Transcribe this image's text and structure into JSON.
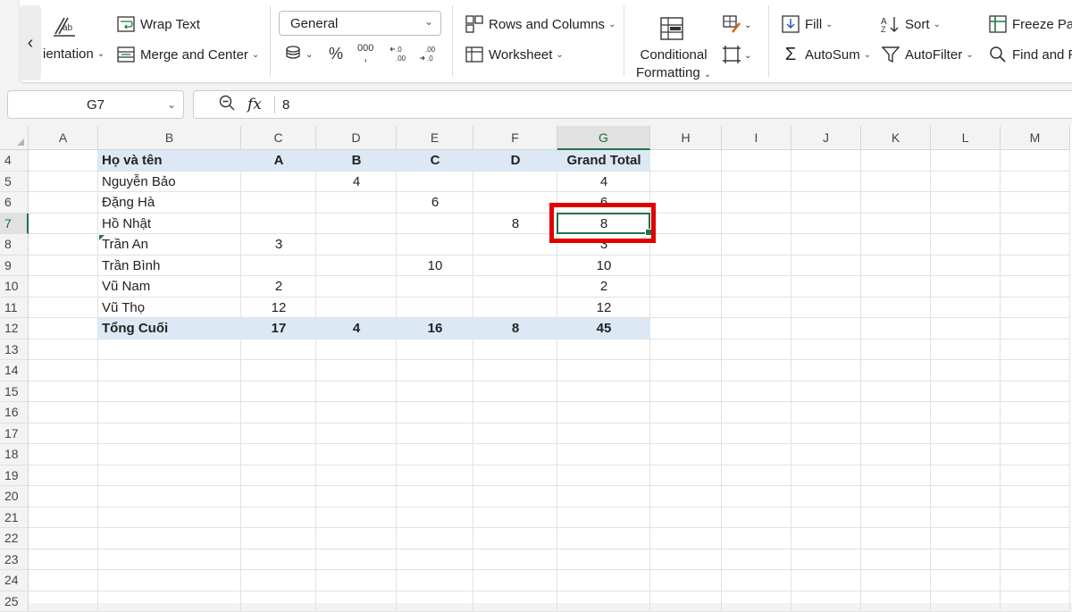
{
  "ribbon": {
    "orientation_label": "ientation",
    "wrap_text": "Wrap Text",
    "merge_center": "Merge and Center",
    "number_format": "General",
    "percent_symbol": "%",
    "comma_symbol": "000",
    "rows_columns": "Rows and Columns",
    "worksheet": "Worksheet",
    "conditional_line1": "Conditional",
    "conditional_line2": "Formatting",
    "fill": "Fill",
    "autosum": "AutoSum",
    "sort": "Sort",
    "autofilter": "AutoFilter",
    "freeze": "Freeze Pan",
    "find": "Find and R"
  },
  "formula_bar": {
    "name_box": "G7",
    "fx_label": "fx",
    "value": "8"
  },
  "columns": [
    "A",
    "B",
    "C",
    "D",
    "E",
    "F",
    "G",
    "H",
    "I",
    "J",
    "K",
    "L",
    "M"
  ],
  "rows": [
    "4",
    "5",
    "6",
    "7",
    "8",
    "9",
    "10",
    "11",
    "12",
    "13",
    "14",
    "15",
    "16",
    "17",
    "18",
    "19",
    "20",
    "21",
    "22",
    "23",
    "24",
    "25"
  ],
  "selected_cell": "G7",
  "table": {
    "header": [
      "Họ và tên",
      "A",
      "B",
      "C",
      "D",
      "Grand Total"
    ],
    "rows": [
      [
        "Nguyễn Bảo",
        "",
        "4",
        "",
        "",
        "4"
      ],
      [
        "Đặng Hà",
        "",
        "",
        "6",
        "",
        "6"
      ],
      [
        "Hồ Nhật",
        "",
        "",
        "",
        "8",
        "8"
      ],
      [
        "Trần An",
        "3",
        "",
        "",
        "",
        "3"
      ],
      [
        "Trần Bình",
        "",
        "",
        "10",
        "",
        "10"
      ],
      [
        "Vũ Nam",
        "2",
        "",
        "",
        "",
        "2"
      ],
      [
        "Vũ Thọ",
        "12",
        "",
        "",
        "",
        "12"
      ]
    ],
    "total": [
      "Tổng Cuối",
      "17",
      "4",
      "16",
      "8",
      "45"
    ]
  },
  "colors": {
    "accent_green": "#217346",
    "header_band": "#dce9f5",
    "highlight_red": "#e00000"
  }
}
